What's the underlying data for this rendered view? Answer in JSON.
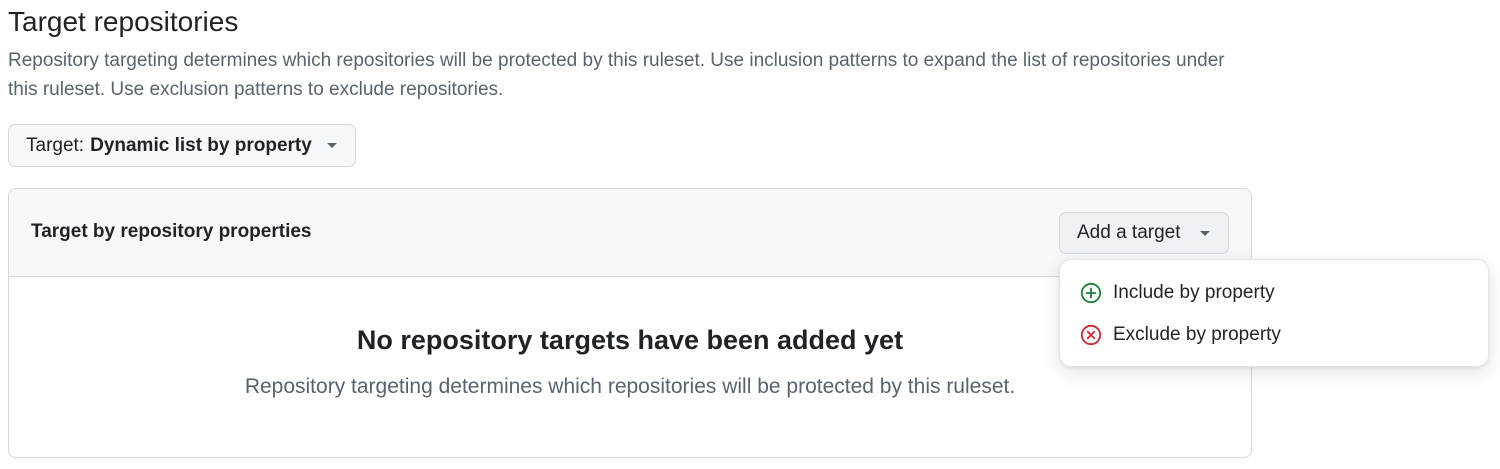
{
  "section": {
    "title": "Target repositories",
    "description": "Repository targeting determines which repositories will be protected by this ruleset. Use inclusion patterns to expand the list of repositories under this ruleset. Use exclusion patterns to exclude repositories."
  },
  "target_select": {
    "prefix": "Target:",
    "value": "Dynamic list by property",
    "icon": "triangle-down-icon"
  },
  "properties_box": {
    "title": "Target by repository properties",
    "add_button_label": "Add a target",
    "empty_title": "No repository targets have been added yet",
    "empty_description": "Repository targeting determines which repositories will be protected by this ruleset."
  },
  "add_target_menu": {
    "items": [
      {
        "label": "Include by property",
        "icon": "plus-circle-icon",
        "color": "#1a7f37"
      },
      {
        "label": "Exclude by property",
        "icon": "x-circle-icon",
        "color": "#d1242f"
      }
    ]
  },
  "colors": {
    "text": "#1f2328",
    "muted": "#59636e",
    "border": "#d1d9e0",
    "header_bg": "#f6f8fa"
  }
}
